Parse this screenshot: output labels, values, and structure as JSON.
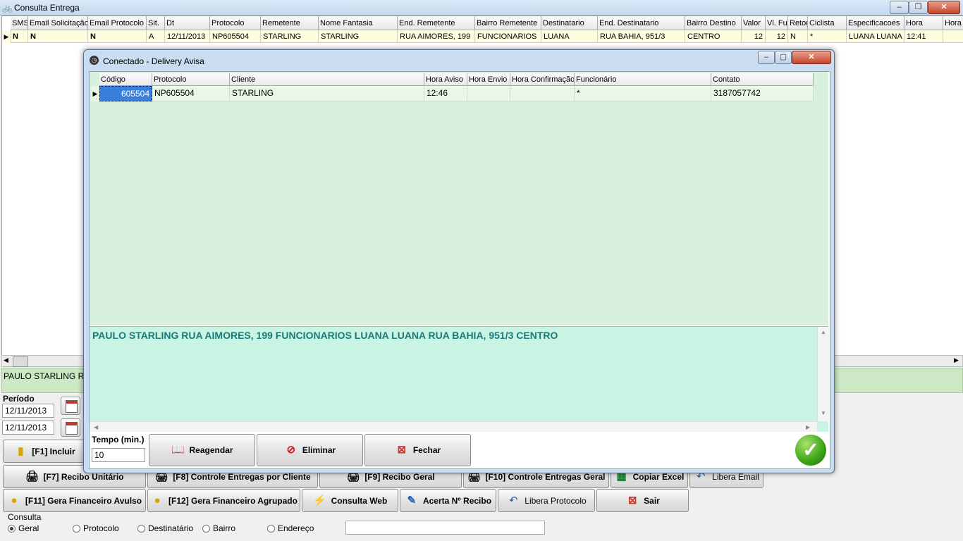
{
  "main_window": {
    "title": "Consulta Entrega",
    "controls": {
      "minimize": "–",
      "maximize": "❐",
      "close": "✕"
    }
  },
  "grid": {
    "columns": [
      "SMS",
      "Email Solicitação",
      "Email Protocolo",
      "Sit.",
      "Dt",
      "Protocolo",
      "Remetente",
      "Nome Fantasia",
      "End. Remetente",
      "Bairro Remetente",
      "Destinatario",
      "End. Destinatario",
      "Bairro Destino",
      "Valor",
      "Vl. Fu",
      "Retor",
      "Ciclista",
      "Especificacoes",
      "Hora",
      "Hora"
    ],
    "row": [
      "N",
      "N",
      "N",
      "A",
      "12/11/2013",
      "NP605504",
      "STARLING",
      "STARLING",
      "RUA AIMORES, 199",
      "FUNCIONARIOS",
      "LUANA",
      "RUA BAHIA, 951/3",
      "CENTRO",
      "12",
      "12",
      "N",
      "*",
      "LUANA LUANA",
      "12:41",
      ""
    ]
  },
  "memo_bar": {
    "text": "PAULO STARLING RUA"
  },
  "period": {
    "label": "Período",
    "date_from": "12/11/2013",
    "date_to": "12/11/2013"
  },
  "buttons": {
    "incluir": "[F1] Incluir",
    "recibo_unitario": "[F7] Recibo Unitário",
    "controle_cliente": "[F8] Controle Entregas por Cliente",
    "recibo_geral": "[F9] Recibo Geral",
    "controle_geral": "[F10] Controle Entregas Geral",
    "copiar_excel": "Copiar Excel",
    "libera_email": "Libera Email",
    "fin_avulso": "[F11] Gera Financeiro Avulso",
    "fin_agrupado": "[F12] Gera Financeiro Agrupado",
    "consulta_web": "Consulta  Web",
    "acerta_recibo": "Acerta Nº Recibo",
    "libera_protocolo": "Libera Protocolo",
    "sair": "Sair"
  },
  "consulta": {
    "label": "Consulta",
    "options": [
      "Geral",
      "Protocolo",
      "Destinatário",
      "Bairro",
      "Endereço"
    ],
    "selected": "Geral",
    "search_value": ""
  },
  "dialog": {
    "title": "Conectado - Delivery Avisa",
    "columns": [
      "Código",
      "Protocolo",
      "Cliente",
      "Hora Aviso",
      "Hora Envio",
      "Hora Confirmação",
      "Funcionário",
      "Contato"
    ],
    "row": [
      "605504",
      "NP605504",
      "STARLING",
      "12:46",
      "",
      "",
      "*",
      "3187057742"
    ],
    "memo": "PAULO STARLING RUA AIMORES, 199 FUNCIONARIOS LUANA LUANA RUA BAHIA, 951/3 CENTRO",
    "tempo_label": "Tempo (min.)",
    "tempo_value": "10",
    "reagendar": "Reagendar",
    "eliminar": "Eliminar",
    "fechar": "Fechar",
    "colors": {
      "grid_bg": "#d9f1dc",
      "memo_bg": "#c9f3e3",
      "memo_text": "#1b7a7a",
      "ok": "#3aa314"
    }
  }
}
